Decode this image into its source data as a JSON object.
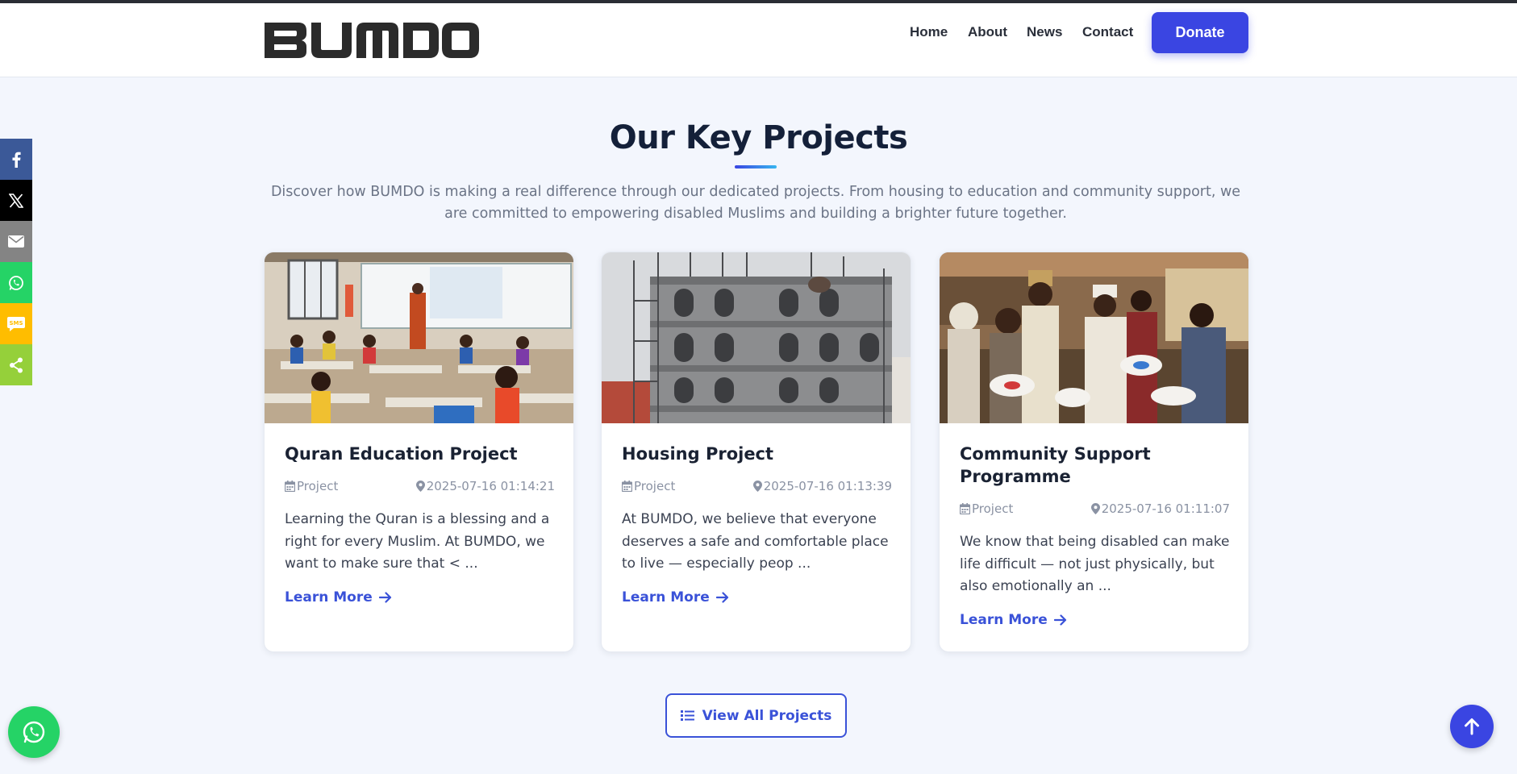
{
  "header": {
    "logo_text": "BUMDO",
    "nav": [
      "Home",
      "About",
      "News",
      "Contact"
    ],
    "donate_label": "Donate"
  },
  "section": {
    "title": "Our Key Projects",
    "intro": "Discover how BUMDO is making a real difference through our dedicated projects. From housing to education and community support, we are committed to empowering disabled Muslims and building a brighter future together."
  },
  "projects": [
    {
      "title": "Quran Education Project",
      "category": "Project",
      "date": "2025-07-16 01:14:21",
      "description": "Learning the Quran is a blessing and a right for every Muslim. At BUMDO, we want to make sure that < ...",
      "link_label": "Learn More",
      "image": "classroom-photo"
    },
    {
      "title": "Housing Project",
      "category": "Project",
      "date": "2025-07-16 01:13:39",
      "description": "At BUMDO, we believe that everyone deserves a safe and comfortable place to live — especially peop ...",
      "link_label": "Learn More",
      "image": "building-construction-photo"
    },
    {
      "title": "Community Support Programme",
      "category": "Project",
      "date": "2025-07-16 01:11:07",
      "description": "We know that being disabled can make life difficult — not just physically, but also emotionally an ...",
      "link_label": "Learn More",
      "image": "food-distribution-photo"
    }
  ],
  "view_all_label": "View All Projects",
  "social_bar": [
    {
      "icon": "facebook-icon",
      "color": "#3b5998"
    },
    {
      "icon": "x-icon",
      "color": "#000000"
    },
    {
      "icon": "email-icon",
      "color": "#848484"
    },
    {
      "icon": "whatsapp-icon",
      "color": "#25d366"
    },
    {
      "icon": "sms-icon",
      "color": "#ffbd00"
    },
    {
      "icon": "share-icon",
      "color": "#95d03a"
    }
  ],
  "colors": {
    "accent": "#3a45e2",
    "link": "#3a52d8",
    "background": "#f3f6fd"
  }
}
